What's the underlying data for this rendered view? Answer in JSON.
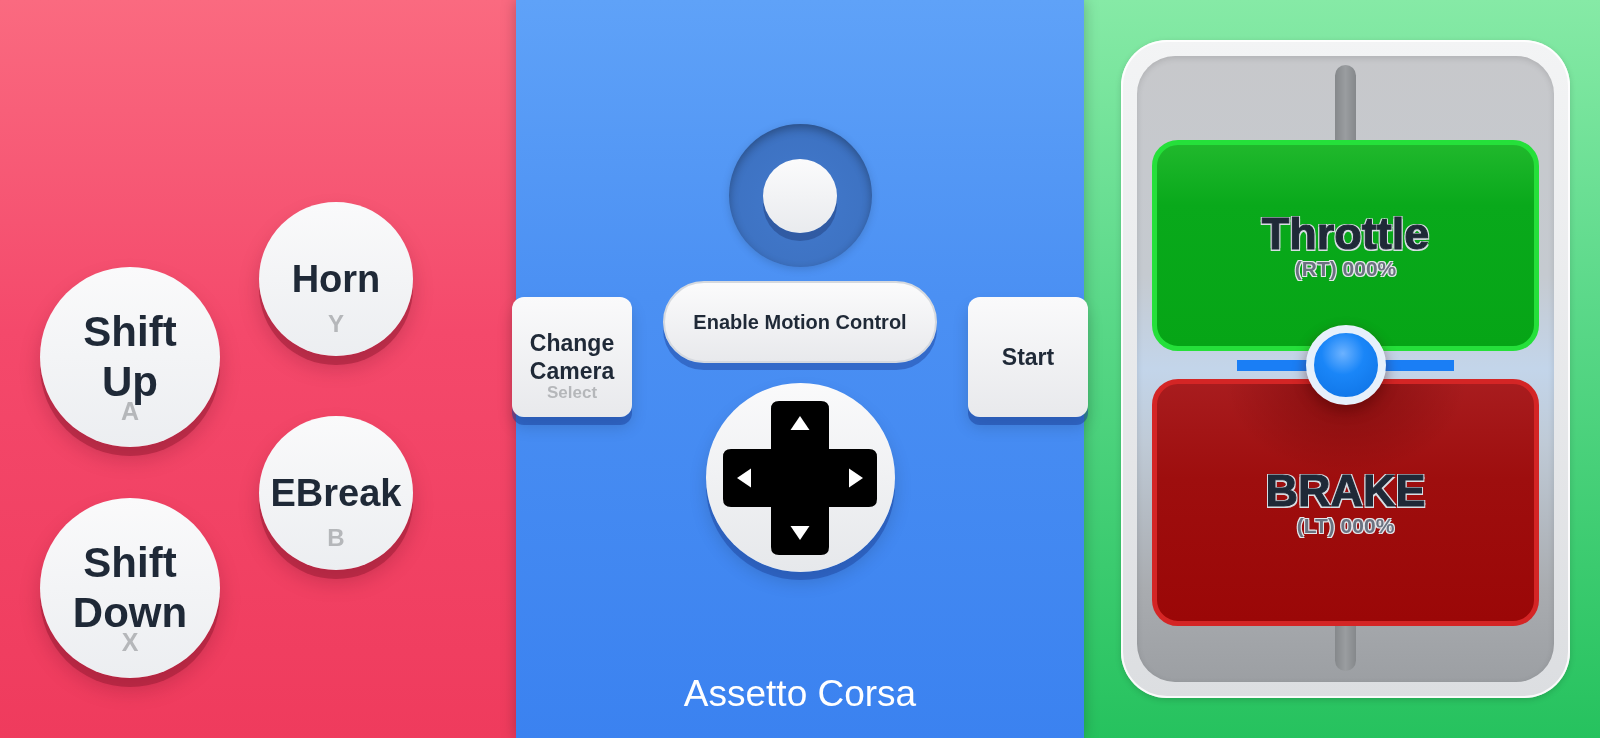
{
  "left_panel": {
    "columns": [
      {
        "buttons": [
          {
            "kind": "large",
            "label": "Shift Up",
            "key": "A"
          },
          {
            "kind": "large",
            "label": "Shift Down",
            "key": "X"
          }
        ]
      },
      {
        "buttons": [
          {
            "kind": "small",
            "label": "Horn",
            "key": "Y"
          },
          {
            "kind": "small",
            "label": "EBreak",
            "key": "B"
          }
        ]
      }
    ]
  },
  "center_panel": {
    "buttons": [
      {
        "kind": "square",
        "label": "Change Camera",
        "key": "Select"
      },
      {
        "kind": "pill",
        "label": "Enable Motion Control"
      },
      {
        "kind": "square",
        "label": "Start"
      }
    ],
    "title": "Assetto Corsa"
  },
  "right_panel": {
    "pedals": [
      {
        "kind": "throttle",
        "label": "Throttle",
        "reading": "(RT) 000%"
      },
      {
        "kind": "brake",
        "label": "BRAKE",
        "reading": "(LT) 000%"
      }
    ],
    "slider": {
      "level": 0.5
    }
  }
}
